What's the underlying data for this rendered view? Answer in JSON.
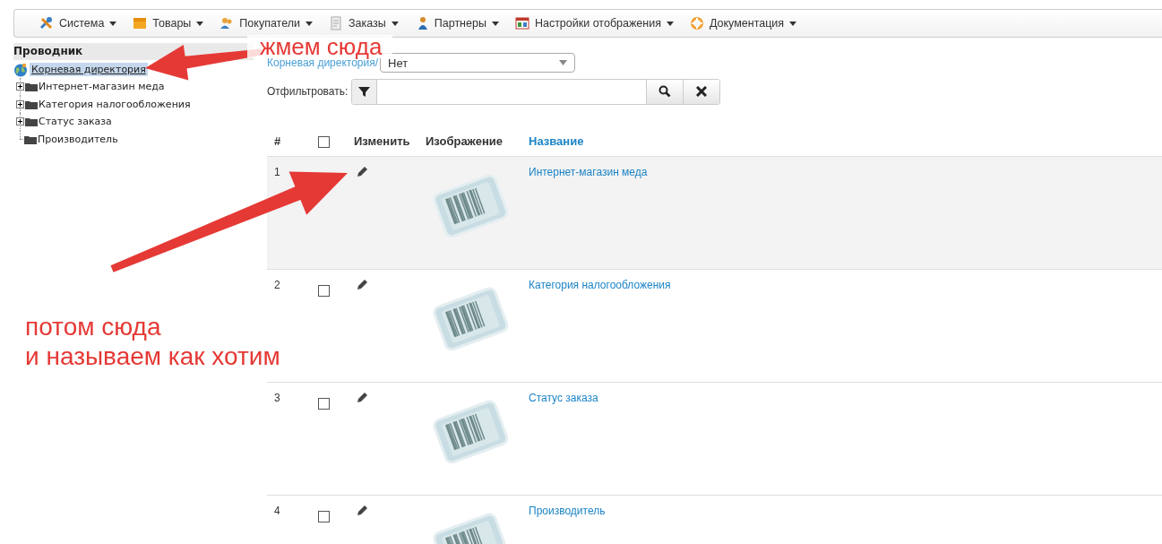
{
  "menu": [
    {
      "label": "Система"
    },
    {
      "label": "Товары"
    },
    {
      "label": "Покупатели"
    },
    {
      "label": "Заказы"
    },
    {
      "label": "Партнеры"
    },
    {
      "label": "Настройки отображения"
    },
    {
      "label": "Документация"
    }
  ],
  "sidebar": {
    "title": "Проводник",
    "root": {
      "label": "Корневая директория",
      "selected": true,
      "children": [
        {
          "label": "Интернет-магазин меда",
          "kind": "branch",
          "selected": false
        },
        {
          "label": "Категория налогообложения",
          "kind": "branch",
          "selected": false
        },
        {
          "label": "Статус заказа",
          "kind": "branch",
          "selected": false
        },
        {
          "label": "Производитель",
          "kind": "leaf",
          "selected": false
        }
      ]
    }
  },
  "breadcrumb": "Корневая директория/",
  "select": {
    "value": "Нет"
  },
  "filter": {
    "label": "Отфильтровать:"
  },
  "table": {
    "columns": [
      "#",
      "Изменить",
      "Изображение",
      "Название"
    ],
    "header_checked": false,
    "rows": [
      {
        "number": "1",
        "name": "Интернет-магазин меда",
        "highlighted": true
      },
      {
        "number": "2",
        "checked": false,
        "name": "Категория налогообложения",
        "highlighted": false
      },
      {
        "number": "3",
        "checked": false,
        "name": "Статус заказа",
        "highlighted": false
      },
      {
        "number": "4",
        "checked": false,
        "name": "Производитель",
        "highlighted": false
      }
    ]
  },
  "annotations": [
    {
      "lines": [
        "жмем сюда"
      ],
      "kind": "boxed"
    },
    {
      "lines": [
        "потом сюда",
        "и называем как хотим"
      ],
      "kind": "plain"
    }
  ]
}
